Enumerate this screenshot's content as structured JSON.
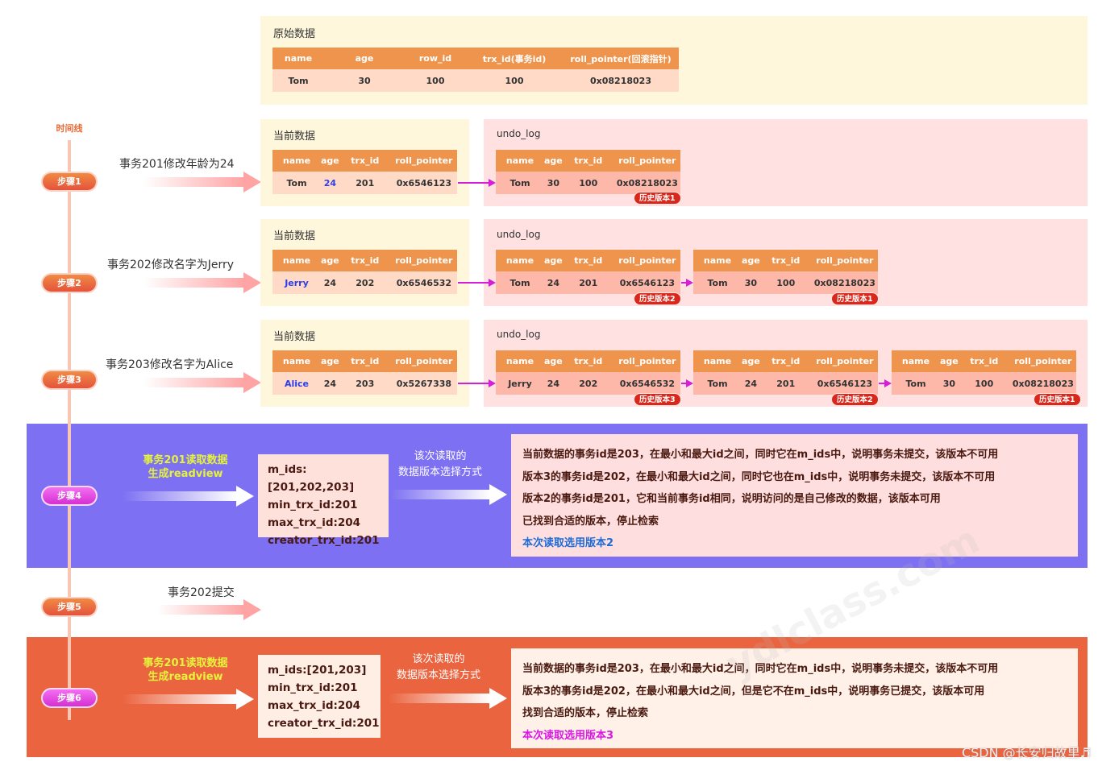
{
  "timeline": {
    "title": "时间线"
  },
  "steps": [
    {
      "label": "步骤1"
    },
    {
      "label": "步骤2"
    },
    {
      "label": "步骤3"
    },
    {
      "label": "步骤4"
    },
    {
      "label": "步骤5"
    },
    {
      "label": "步骤6"
    }
  ],
  "events": [
    "事务201修改年龄为24",
    "事务202修改名字为Jerry",
    "事务203修改名字为Alice",
    "事务202提交"
  ],
  "original": {
    "title": "原始数据",
    "headers": [
      "name",
      "age",
      "row_id",
      "trx_id(事务id)",
      "roll_pointer(回滚指针)"
    ],
    "row": [
      "Tom",
      "30",
      "100",
      "100",
      "0x08218023"
    ]
  },
  "current_title": "当前数据",
  "undo_title": "undo_log",
  "table_headers": [
    "name",
    "age",
    "trx_id",
    "roll_pointer"
  ],
  "step1": {
    "current": [
      "Tom",
      "24",
      "201",
      "0x6546123"
    ],
    "undo": [
      {
        "row": [
          "Tom",
          "30",
          "100",
          "0x08218023"
        ],
        "badge": "历史版本1"
      }
    ]
  },
  "step2": {
    "current": [
      "Jerry",
      "24",
      "202",
      "0x6546532"
    ],
    "undo": [
      {
        "row": [
          "Tom",
          "24",
          "201",
          "0x6546123"
        ],
        "badge": "历史版本2"
      },
      {
        "row": [
          "Tom",
          "30",
          "100",
          "0x08218023"
        ],
        "badge": "历史版本1"
      }
    ]
  },
  "step3": {
    "current": [
      "Alice",
      "24",
      "203",
      "0x5267338"
    ],
    "undo": [
      {
        "row": [
          "Jerry",
          "24",
          "202",
          "0x6546532"
        ],
        "badge": "历史版本3"
      },
      {
        "row": [
          "Tom",
          "24",
          "201",
          "0x6546123"
        ],
        "badge": "历史版本2"
      },
      {
        "row": [
          "Tom",
          "30",
          "100",
          "0x08218023"
        ],
        "badge": "历史版本1"
      }
    ]
  },
  "step4": {
    "label_line1": "事务201读取数据",
    "label_line2": "生成readview",
    "readview": [
      "m_ids:[201,202,203]",
      "min_trx_id:201",
      "max_trx_id:204",
      "creator_trx_id:201"
    ],
    "mode_line1": "该次读取的",
    "mode_line2": "数据版本选择方式",
    "explanation": [
      "当前数据的事务id是203，在最小和最大id之间，同时它在m_ids中，说明事务未提交，该版本不可用",
      "版本3的事务id是202，在最小和最大id之间，同时它也在m_ids中，说明事务未提交，该版本不可用",
      "版本2的事务id是201，它和当前事务id相同，说明访问的是自己修改的数据，该版本可用",
      "已找到合适的版本，停止检索"
    ],
    "result": "本次读取选用版本2"
  },
  "step6": {
    "label_line1": "事务201读取数据",
    "label_line2": "生成readview",
    "readview": [
      "m_ids:[201,203]",
      "min_trx_id:201",
      "max_trx_id:204",
      "creator_trx_id:201"
    ],
    "mode_line1": "该次读取的",
    "mode_line2": "数据版本选择方式",
    "explanation": [
      "当前数据的事务id是203，在最小和最大id之间，同时它在m_ids中，说明事务未提交，该版本不可用",
      "版本3的事务id是202，在最小和最大id之间，但是它不在m_ids中，说明事务已提交，该版本可用",
      "找到合适的版本，停止检索"
    ],
    "result": "本次读取选用版本3"
  },
  "watermark": "ydlclass.com",
  "credit": "CSDN @长安归故里♬",
  "colors": {
    "header_orange": "#ee944c",
    "band_purple": "#7d70f2",
    "band_orange": "#eb6440",
    "badge_red": "#d9281b",
    "link_magenta": "#d51ed5"
  }
}
